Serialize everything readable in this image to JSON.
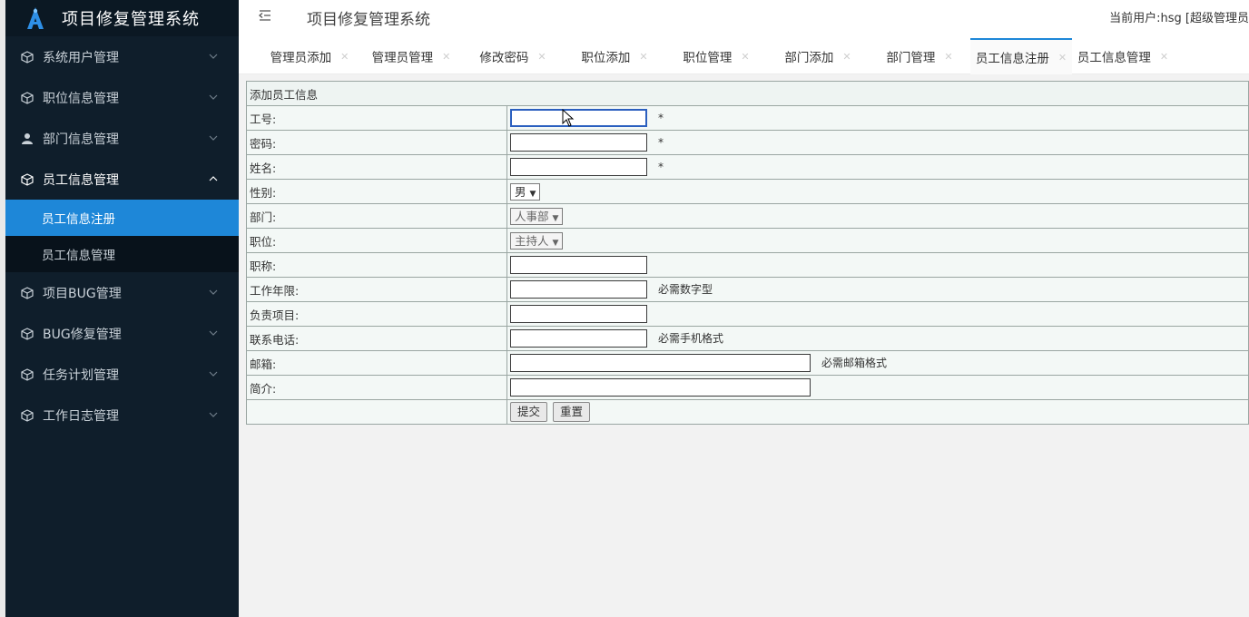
{
  "app": {
    "title": "项目修复管理系统",
    "current_user": "当前用户:hsg [超级管理员"
  },
  "sidebar": {
    "items": [
      {
        "label": "系统用户管理",
        "icon": "cube-icon"
      },
      {
        "label": "职位信息管理",
        "icon": "cube-icon"
      },
      {
        "label": "部门信息管理",
        "icon": "user-icon"
      },
      {
        "label": "员工信息管理",
        "icon": "cube-icon",
        "expanded": true,
        "children": [
          {
            "label": "员工信息注册",
            "active": true
          },
          {
            "label": "员工信息管理",
            "active": false
          }
        ]
      },
      {
        "label": "项目BUG管理",
        "icon": "cube-icon"
      },
      {
        "label": "BUG修复管理",
        "icon": "cube-icon"
      },
      {
        "label": "任务计划管理",
        "icon": "cube-icon"
      },
      {
        "label": "工作日志管理",
        "icon": "cube-icon"
      }
    ]
  },
  "tabs": [
    {
      "label": "管理员添加"
    },
    {
      "label": "管理员管理"
    },
    {
      "label": "修改密码"
    },
    {
      "label": "职位添加"
    },
    {
      "label": "职位管理"
    },
    {
      "label": "部门添加"
    },
    {
      "label": "部门管理"
    },
    {
      "label": "员工信息注册",
      "active": true
    },
    {
      "label": "员工信息管理"
    }
  ],
  "form": {
    "caption": "添加员工信息",
    "fields": {
      "emp_no": {
        "label": "工号:",
        "value": "",
        "suffix": "*"
      },
      "password": {
        "label": "密码:",
        "value": "",
        "suffix": "*"
      },
      "name": {
        "label": "姓名:",
        "value": "",
        "suffix": "*"
      },
      "gender": {
        "label": "性别:",
        "selected": "男"
      },
      "department": {
        "label": "部门:",
        "selected": "人事部"
      },
      "position": {
        "label": "职位:",
        "selected": "主持人"
      },
      "title": {
        "label": "职称:",
        "value": ""
      },
      "years": {
        "label": "工作年限:",
        "value": "",
        "hint": "必需数字型"
      },
      "project": {
        "label": "负责项目:",
        "value": ""
      },
      "phone": {
        "label": "联系电话:",
        "value": "",
        "hint": "必需手机格式"
      },
      "email": {
        "label": "邮箱:",
        "value": "",
        "hint": "必需邮箱格式"
      },
      "intro": {
        "label": "简介:",
        "value": ""
      }
    },
    "submit_label": "提交",
    "reset_label": "重置"
  },
  "colors": {
    "sidebar_bg": "#0f1e2b",
    "active_blue": "#1e87d8"
  }
}
